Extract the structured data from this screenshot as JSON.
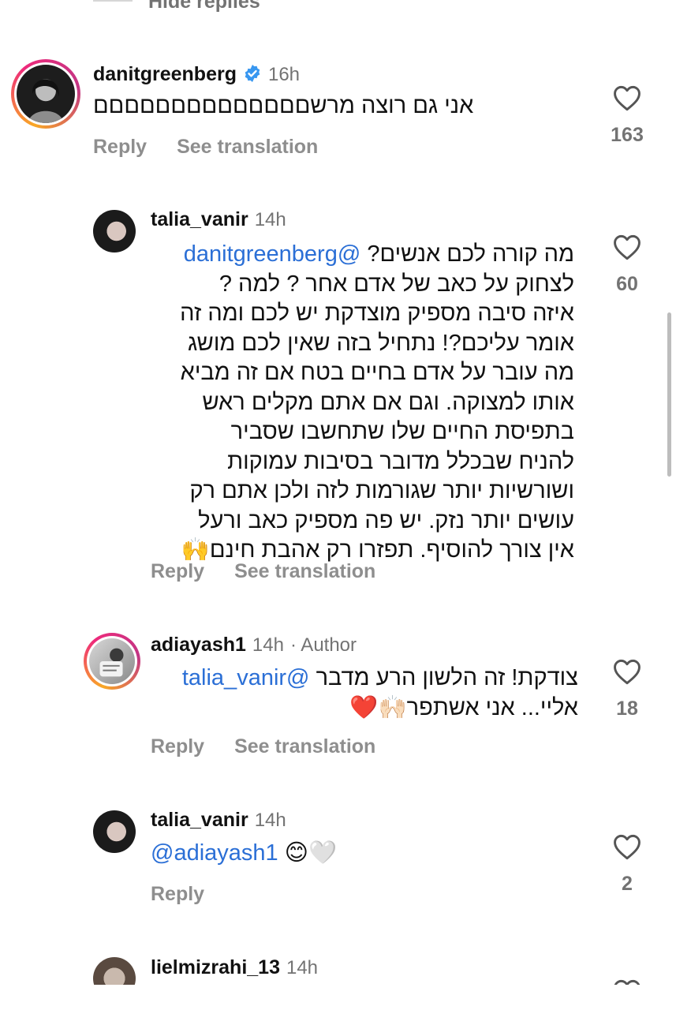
{
  "hide_replies_label": "Hide replies",
  "colors": {
    "mention": "#2b6fd6",
    "muted": "#737373",
    "verified": "#3897f0"
  },
  "comments": [
    {
      "username": "danitgreenberg",
      "verified": true,
      "time": "16h",
      "text": "אני גם רוצה מרשםםםםםםםםםםםםםם",
      "reply_label": "Reply",
      "translate_label": "See translation",
      "likes": "163"
    },
    {
      "username": "talia_vanir",
      "time": "14h",
      "mention": "@danitgreenberg",
      "lines": [
        "מה קורה לכם אנשים?",
        "לצחוק על כאב של אדם אחר ? למה ?",
        "איזה סיבה מספיק מוצדקת יש לכם ומה זה",
        "אומר עליכם?! נתחיל בזה שאין לכם מושג",
        "מה עובר על אדם בחיים בטח אם זה מביא",
        "אותו למצוקה. וגם אם אתם מקלים ראש",
        "בתפיסת החיים שלו שתחשבו שסביר",
        "להניח שבכלל מדובר בסיבות עמוקות",
        "ושורשיות יותר שגורמות לזה ולכן אתם רק",
        "עושים יותר נזק. יש פה מספיק כאב ורעל",
        "אין צורך להוסיף. תפזרו רק אהבת חינם🙌"
      ],
      "reply_label": "Reply",
      "translate_label": "See translation",
      "likes": "60"
    },
    {
      "username": "adiayash1",
      "time": "14h",
      "author_label": "· Author",
      "mention": "@talia_vanir",
      "line1": "צודקת! זה הלשון הרע מדבר",
      "line2": "אליי... אני אשתפר🙌🏻❤️",
      "reply_label": "Reply",
      "translate_label": "See translation",
      "likes": "18"
    },
    {
      "username": "talia_vanir",
      "time": "14h",
      "mention": "@adiayash1",
      "emoji": "😊🤍",
      "reply_label": "Reply",
      "likes": "2"
    },
    {
      "username": "lielmizrahi_13",
      "time": "14h"
    }
  ]
}
